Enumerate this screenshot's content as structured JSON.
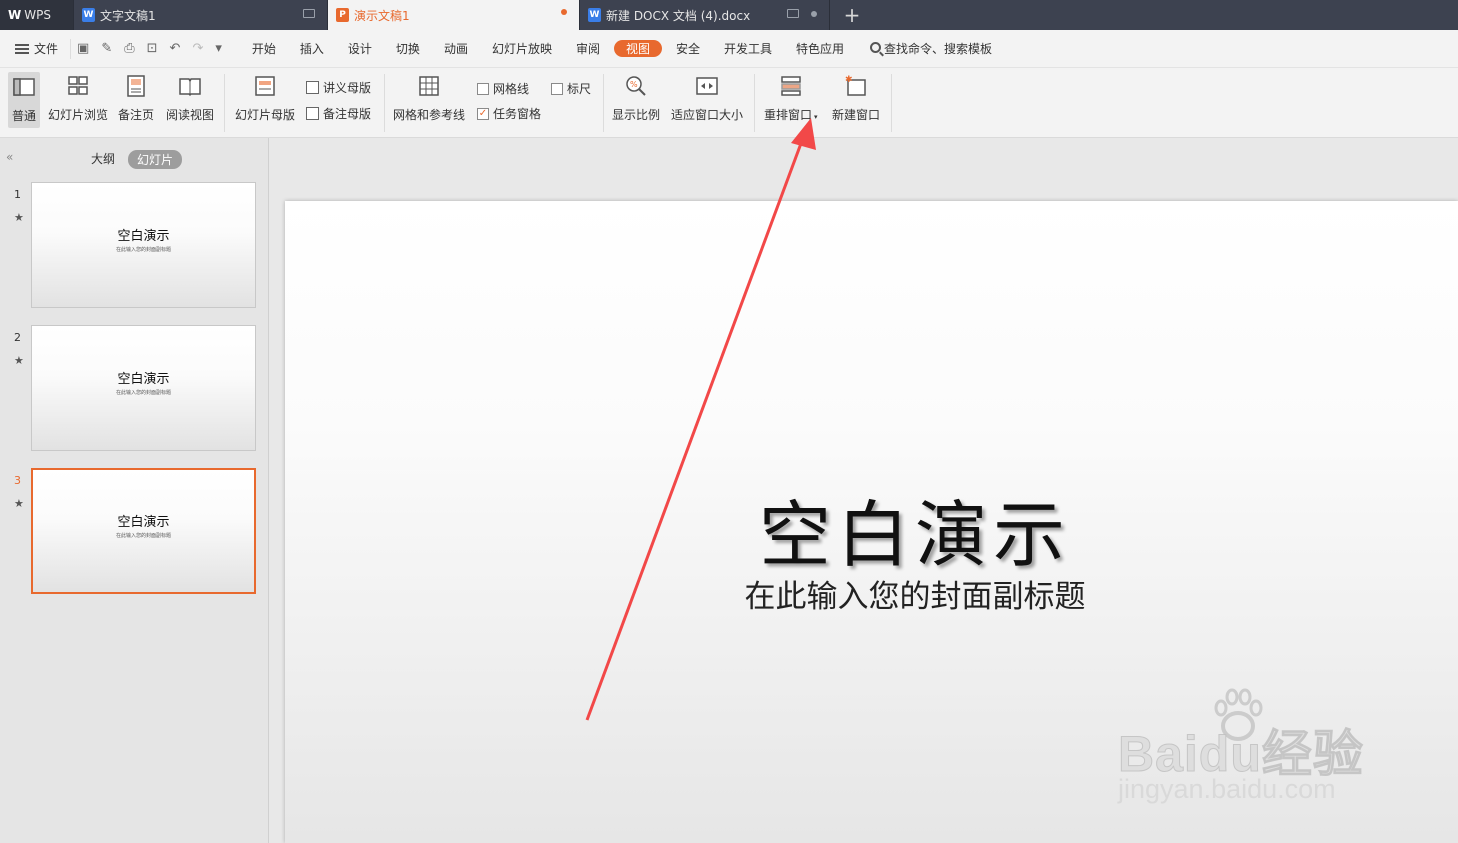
{
  "tabs": [
    {
      "label": "WPS",
      "icon": "wps-logo-icon"
    },
    {
      "label": "文字文稿1",
      "icon": "writer-doc-icon"
    },
    {
      "label": "演示文稿1",
      "icon": "presentation-doc-icon"
    },
    {
      "label": "新建 DOCX 文档 (4).docx",
      "icon": "writer-doc-icon"
    }
  ],
  "menubar": {
    "file": "文件",
    "menus": [
      "开始",
      "插入",
      "设计",
      "切换",
      "动画",
      "幻灯片放映",
      "审阅",
      "视图",
      "安全",
      "开发工具",
      "特色应用"
    ],
    "active_menu": "视图",
    "search": "查找命令、搜索模板"
  },
  "ribbon": {
    "normal": "普通",
    "slide_browse": "幻灯片浏览",
    "notes_page": "备注页",
    "reading_view": "阅读视图",
    "slide_master": "幻灯片母版",
    "handout_master": "讲义母版",
    "notes_master": "备注母版",
    "grid_guides": "网格和参考线",
    "gridlines": "网格线",
    "ruler": "标尺",
    "task_pane": "任务窗格",
    "zoom": "显示比例",
    "fit_window": "适应窗口大小",
    "arrange_windows": "重排窗口",
    "new_window": "新建窗口",
    "gridlines_checked": false,
    "ruler_checked": false,
    "task_pane_checked": true
  },
  "panel": {
    "outline_tab": "大纲",
    "slides_tab": "幻灯片",
    "slides": [
      {
        "num": "1",
        "title": "空白演示",
        "subtitle": "在此输入您的封面副标题"
      },
      {
        "num": "2",
        "title": "空白演示",
        "subtitle": "在此输入您的封面副标题"
      },
      {
        "num": "3",
        "title": "空白演示",
        "subtitle": "在此输入您的封面副标题"
      }
    ],
    "selected": 3
  },
  "slide": {
    "title": "空白演示",
    "subtitle": "在此输入您的封面副标题"
  },
  "watermark": {
    "brand": "Baidu经验",
    "url": "jingyan.baidu.com"
  },
  "colors": {
    "accent": "#e8692e",
    "arrow": "#f24848"
  }
}
